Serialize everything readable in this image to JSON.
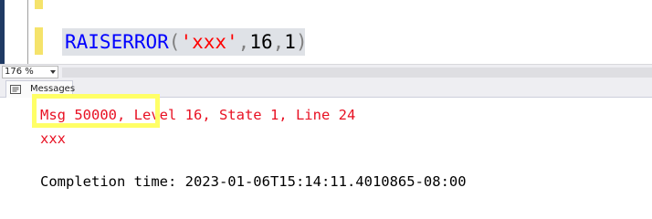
{
  "editor": {
    "code": {
      "keyword": "RAISERROR",
      "open_paren": "(",
      "string": "'xxx'",
      "comma1": ",",
      "severity": "16",
      "comma2": ",",
      "state": "1",
      "close_paren": ")"
    }
  },
  "zoom": {
    "value": "176 %"
  },
  "results": {
    "tab_label": "Messages",
    "messages": {
      "line1_highlighted": "Msg 50000,",
      "line1_rest": " Level 16, State 1, Line 24",
      "line2": "xxx",
      "completion": "Completion time: 2023-01-06T15:14:11.4010865-08:00"
    }
  },
  "colors": {
    "keyword": "#0000ff",
    "string": "#ff0000",
    "error_text": "#e81123",
    "highlight": "#ffff66",
    "change_marker": "#f5e36b"
  },
  "icons": [
    "messages-icon",
    "dropdown-arrow-icon"
  ]
}
